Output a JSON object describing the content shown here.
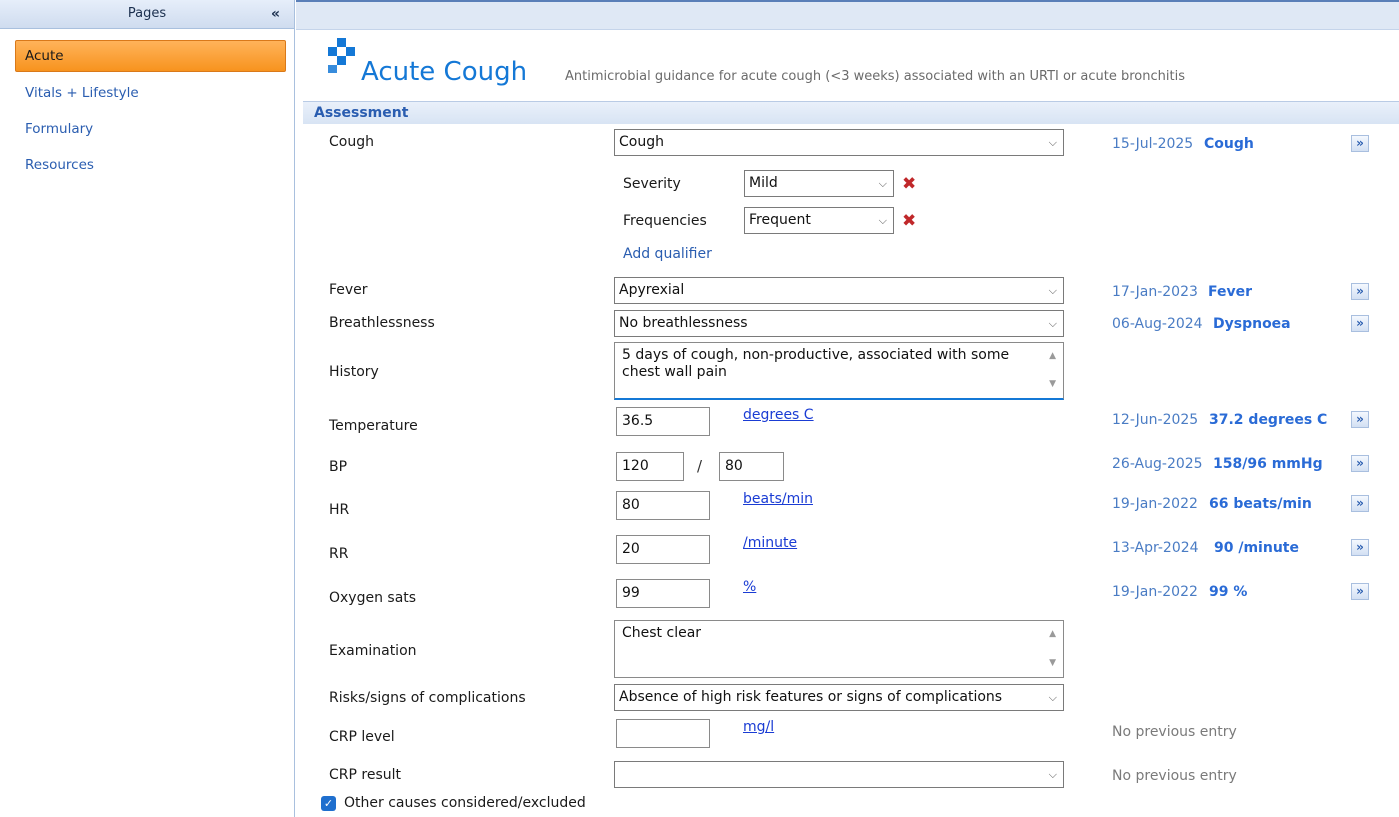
{
  "sidebar": {
    "title": "Pages",
    "collapse_icon": "«",
    "items": [
      {
        "label": "Acute",
        "active": true
      },
      {
        "label": "Vitals + Lifestyle"
      },
      {
        "label": "Formulary"
      },
      {
        "label": "Resources"
      }
    ]
  },
  "header": {
    "title": "Acute Cough",
    "subtitle": "Antimicrobial guidance for acute cough (<3 weeks) associated with an URTI or acute bronchitis",
    "logo_color": "#1478d6"
  },
  "section": {
    "title": "Assessment"
  },
  "form": {
    "cough": {
      "label": "Cough",
      "value": "Cough",
      "hist_date": "15-Jul-2025",
      "hist_value": "Cough"
    },
    "severity": {
      "label": "Severity",
      "value": "Mild"
    },
    "frequencies": {
      "label": "Frequencies",
      "value": "Frequent"
    },
    "add_qualifier": "Add qualifier",
    "fever": {
      "label": "Fever",
      "value": "Apyrexial",
      "hist_date": "17-Jan-2023",
      "hist_value": "Fever"
    },
    "breathlessness": {
      "label": "Breathlessness",
      "value": "No breathlessness",
      "hist_date": "06-Aug-2024",
      "hist_value": "Dyspnoea"
    },
    "history": {
      "label": "History",
      "line1": "5 days of cough, non-productive, associated with some",
      "line2": "chest wall pain"
    },
    "temperature": {
      "label": "Temperature",
      "value": "36.5",
      "unit": "degrees C",
      "hist_date": "12-Jun-2025",
      "hist_value": "37.2 degrees C"
    },
    "bp": {
      "label": "BP",
      "systolic": "120",
      "separator": "/",
      "diastolic": "80",
      "hist_date": "26-Aug-2025",
      "hist_value": "158/96 mmHg"
    },
    "hr": {
      "label": "HR",
      "value": "80",
      "unit": "beats/min",
      "hist_date": "19-Jan-2022",
      "hist_value": "66 beats/min"
    },
    "rr": {
      "label": "RR",
      "value": "20",
      "unit": "/minute",
      "hist_date": "13-Apr-2024",
      "hist_value": "90 /minute"
    },
    "oxygen": {
      "label": "Oxygen sats",
      "value": "99",
      "unit": "%",
      "hist_date": "19-Jan-2022",
      "hist_value": "99 %"
    },
    "examination": {
      "label": "Examination",
      "value": "Chest clear"
    },
    "risks": {
      "label": "Risks/signs of complications",
      "value": "Absence of high risk features or signs of complications"
    },
    "crp_level": {
      "label": "CRP level",
      "value": "",
      "unit": "mg/l",
      "no_prev": "No previous entry"
    },
    "crp_result": {
      "label": "CRP result",
      "value": "",
      "no_prev": "No previous entry"
    },
    "other_causes": {
      "label": "Other causes considered/excluded",
      "checked": true
    }
  },
  "icons": {
    "chevron": "⌵",
    "go": "»",
    "delete": "✖",
    "check": "✓",
    "scroll_up": "▲",
    "scroll_down": "▼"
  }
}
